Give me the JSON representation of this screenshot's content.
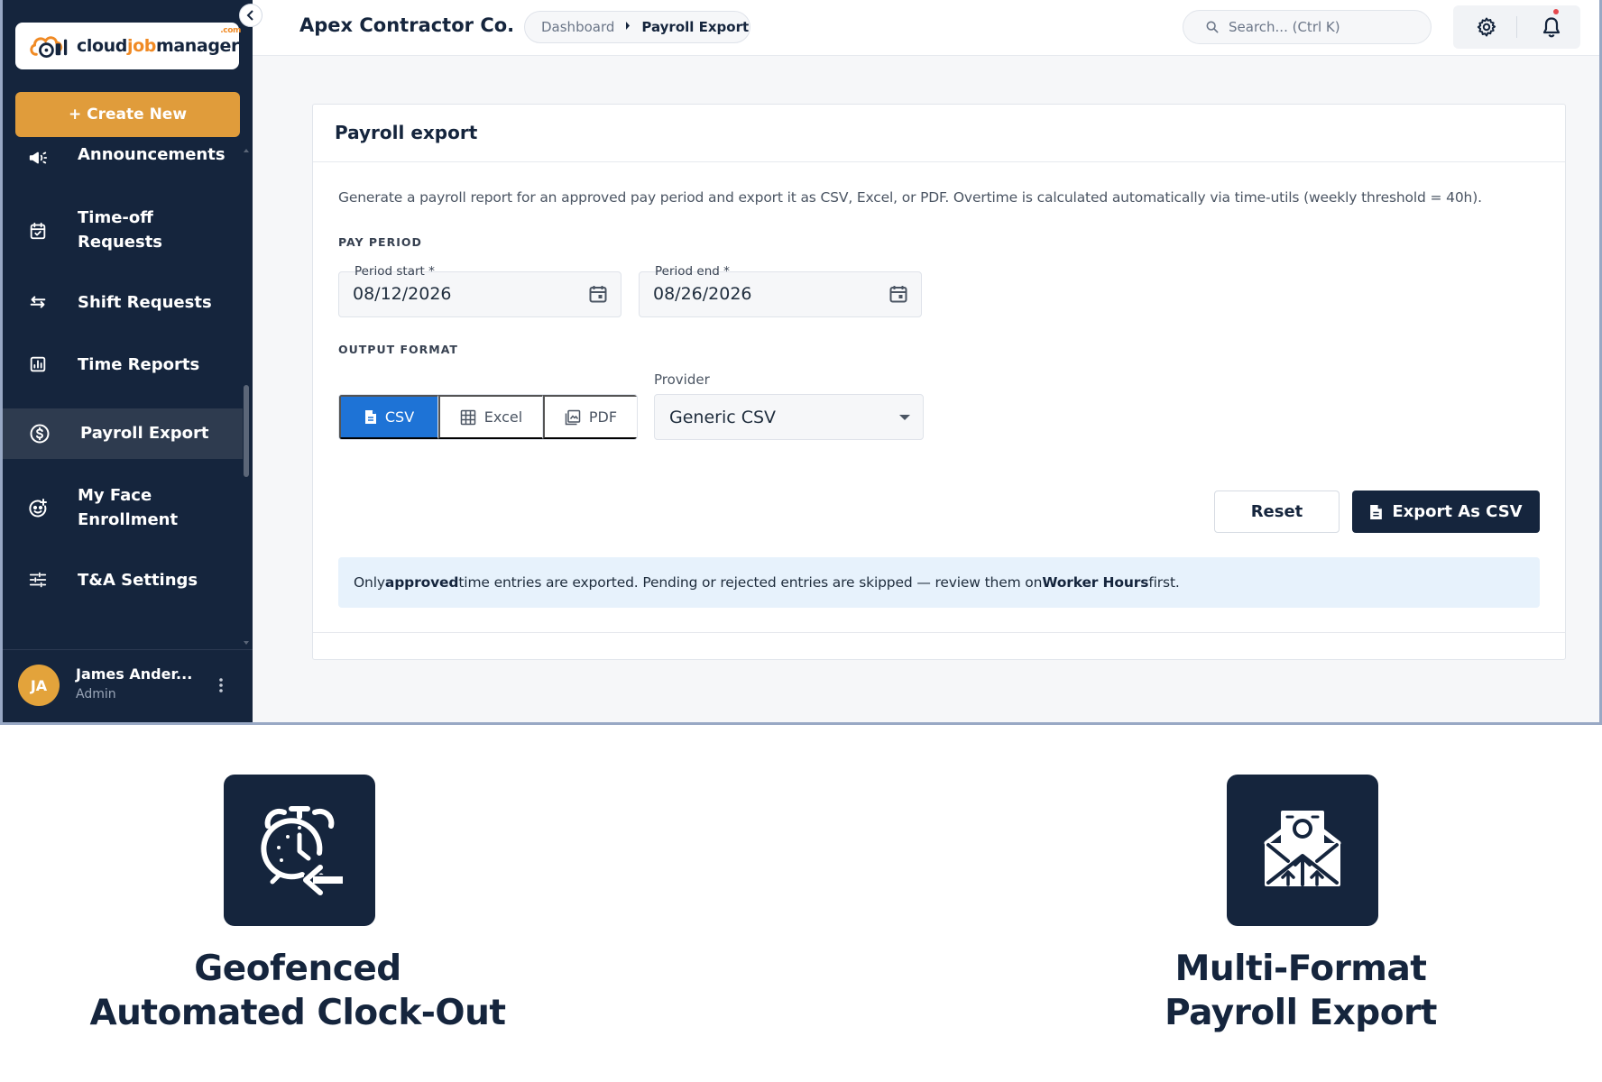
{
  "brand": {
    "logo_text_a": "cloud",
    "logo_text_b": "job",
    "logo_text_c": "manager",
    "logo_suffix": ".com",
    "accent_color": "#e09c3b",
    "navy_color": "#15253d",
    "primary_blue": "#1e73d6"
  },
  "sidebar": {
    "create_label": "+ Create New",
    "items": [
      {
        "label": "Announcements",
        "icon": "megaphone-icon"
      },
      {
        "label": "Time-off",
        "label2": "Requests",
        "icon": "calendar-check-icon"
      },
      {
        "label": "Shift Requests",
        "icon": "swap-arrows-icon"
      },
      {
        "label": "Time Reports",
        "icon": "bar-chart-icon"
      },
      {
        "label": "Payroll Export",
        "icon": "dollar-circle-icon",
        "active": true
      },
      {
        "label": "My Face",
        "label2": "Enrollment",
        "icon": "face-scan-icon"
      },
      {
        "label": "T&A Settings",
        "icon": "sliders-icon"
      }
    ],
    "user": {
      "initials": "JA",
      "name": "James Ander...",
      "role": "Admin"
    }
  },
  "topbar": {
    "company": "Apex Contractor Co.",
    "breadcrumb": [
      "Dashboard",
      "Payroll Export"
    ],
    "search_placeholder": "Search... (Ctrl K)"
  },
  "card": {
    "title": "Payroll export",
    "description": "Generate a payroll report for an approved pay period and export it as CSV, Excel, or PDF. Overtime is calculated automatically via time-utils (weekly threshold = 40h).",
    "pay_period_label": "PAY PERIOD",
    "period_start": {
      "label": "Period start *",
      "value": "08/12/2026"
    },
    "period_end": {
      "label": "Period end *",
      "value": "08/26/2026"
    },
    "output_format_label": "OUTPUT FORMAT",
    "formats": [
      {
        "label": "CSV",
        "active": true
      },
      {
        "label": "Excel",
        "active": false
      },
      {
        "label": "PDF",
        "active": false
      }
    ],
    "provider": {
      "label": "Provider",
      "value": "Generic CSV"
    },
    "reset_label": "Reset",
    "export_label": "Export As CSV",
    "info": {
      "t1": "Only ",
      "b1": "approved",
      "t2": " time entries are exported. Pending or rejected entries are skipped — review them on ",
      "b2": "Worker Hours",
      "t3": " first."
    }
  },
  "features": [
    {
      "icon": "alarm-clock-out-icon",
      "line1": "Geofenced",
      "line2": "Automated Clock-Out"
    },
    {
      "icon": "payroll-envelope-icon",
      "line1": "Multi-Format",
      "line2": "Payroll Export"
    }
  ]
}
